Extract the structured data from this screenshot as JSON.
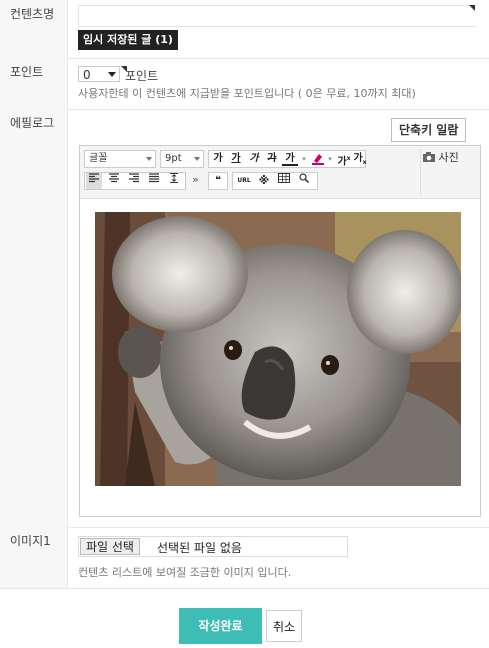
{
  "form": {
    "content_name": {
      "label": "컨텐츠명",
      "value": "",
      "draft_button": "임시 저장된 글 (1)"
    },
    "point": {
      "label": "포인트",
      "selected": "0",
      "unit": "포인트",
      "help": "사용자한테 이 컨텐츠에 지급받을 포인트입니다 ( 0은 무료, 10까지 최대)"
    },
    "epilogue": {
      "label": "에필로그",
      "shortcut_button": "단축키 일람",
      "toolbar": {
        "font_select": "글꼴",
        "size_select": "9pt",
        "bold": "가",
        "underline": "가",
        "italic": "가",
        "strike": "가",
        "font_color": "가",
        "superscript": "가",
        "subscript": "가",
        "quote": "❝",
        "url": "URL",
        "more": "»",
        "photo": "사진"
      },
      "content_image": "koala photo"
    },
    "image1": {
      "label": "이미지1",
      "file_button": "파일 선택",
      "file_status": "선택된 파일 없음",
      "help": "컨텐츠 리스트에 보여질 조금한 이미지 입니다."
    }
  },
  "actions": {
    "submit": "작성완료",
    "cancel": "취소"
  },
  "colors": {
    "submit_bg": "#3dbdb5",
    "draft_bg": "#222222",
    "label_bg": "#f7f7f7"
  }
}
